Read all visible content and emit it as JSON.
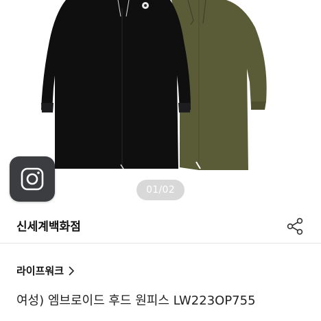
{
  "carousel": {
    "page_indicator": "01/02",
    "garment_colors": [
      "#101010",
      "#5c5e3a"
    ]
  },
  "camera_button": {
    "icon": "camera-icon"
  },
  "store": {
    "name": "신세계백화점",
    "share_icon": "share-icon"
  },
  "product": {
    "brand": "라이프워크",
    "title": "여성) 엠브로이드 후드 원피스 LW223OP755"
  },
  "colors": {
    "divider": "#e4e4e4",
    "camera_bg": "#3b3d40",
    "text": "#111111"
  }
}
